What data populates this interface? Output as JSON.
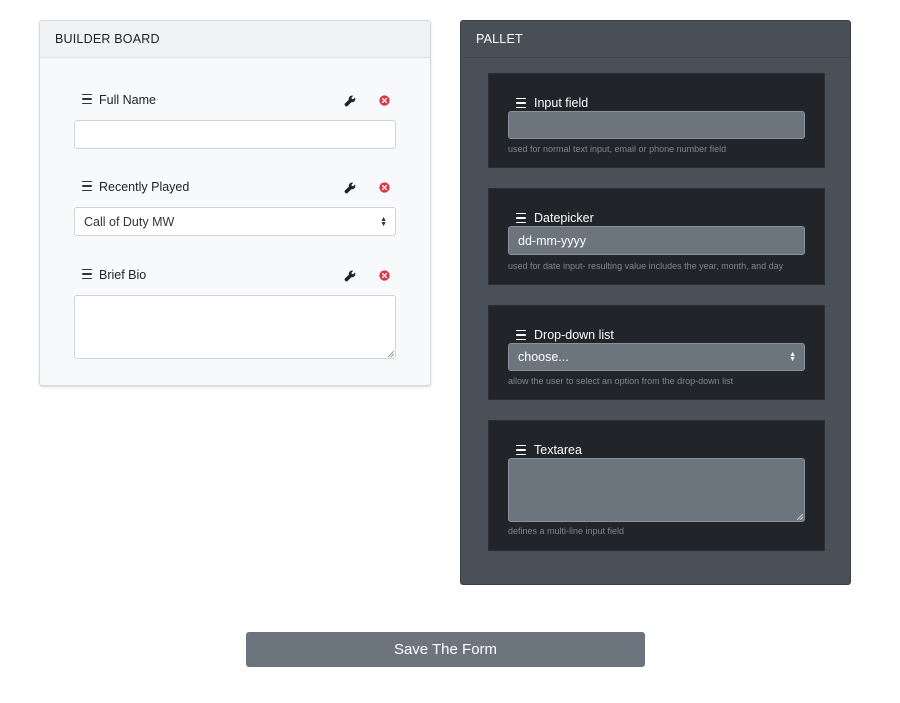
{
  "builder": {
    "title": "BUILDER BOARD",
    "fields": [
      {
        "label": "Full Name",
        "type": "input",
        "value": ""
      },
      {
        "label": "Recently Played",
        "type": "select",
        "value": "Call of Duty MW"
      },
      {
        "label": "Brief Bio",
        "type": "textarea",
        "value": ""
      }
    ]
  },
  "pallet": {
    "title": "PALLET",
    "items": [
      {
        "label": "Input field",
        "type": "input",
        "value": "",
        "help": "used for normal text input, email or phone number field"
      },
      {
        "label": "Datepicker",
        "type": "date",
        "value": "dd-mm-yyyy",
        "help": "used for date input- resulting value includes the year, month, and day"
      },
      {
        "label": "Drop-down list",
        "type": "select",
        "value": "choose...",
        "help": "allow the user to select an option from the drop-down list"
      },
      {
        "label": "Textarea",
        "type": "textarea",
        "value": "",
        "help": "defines a multi-line input field"
      }
    ]
  },
  "save_label": "Save The Form",
  "icons": {
    "drag": "drag-handle-icon",
    "edit": "wrench-icon",
    "remove": "remove-circle-icon",
    "select": "select-arrows-icon"
  },
  "colors": {
    "remove": "#dc3545",
    "pallet_bg": "#495057",
    "pallet_item_bg": "#212428",
    "button_bg": "#6c757d"
  }
}
